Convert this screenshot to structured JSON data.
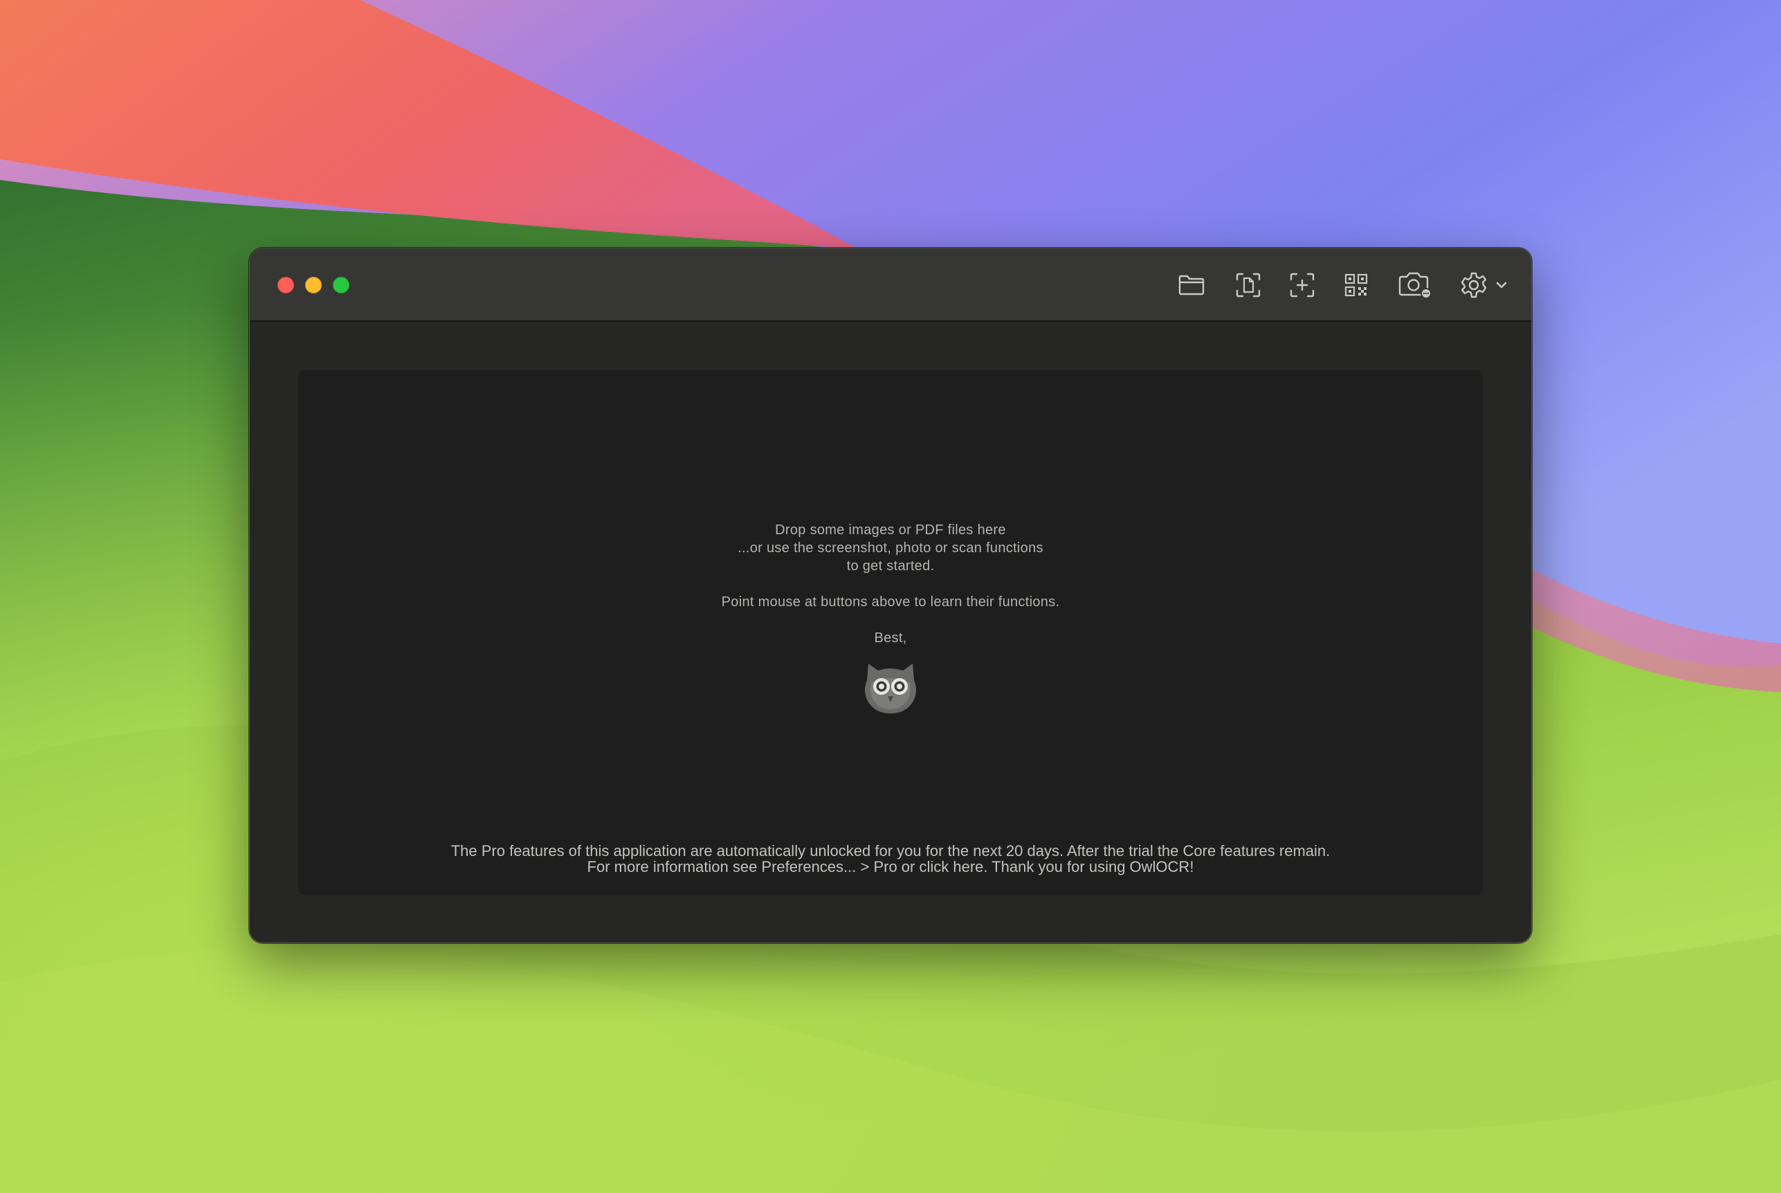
{
  "toolbar": {
    "buttons": [
      {
        "id": "open",
        "icon": "folder-icon"
      },
      {
        "id": "document-scan",
        "icon": "document-scan-icon"
      },
      {
        "id": "screenshot-area",
        "icon": "screenshot-area-icon"
      },
      {
        "id": "qr-code",
        "icon": "qr-code-icon"
      },
      {
        "id": "camera",
        "icon": "camera-icon"
      },
      {
        "id": "settings",
        "icon": "gear-icon"
      }
    ]
  },
  "welcome": {
    "line1": "Drop some images or PDF files here",
    "line2": "...or use the screenshot, photo or scan functions",
    "line3": "to get started.",
    "line4": "Point mouse at buttons above to learn their functions.",
    "signoff": "Best,",
    "mascot_icon": "owl-icon"
  },
  "trial_notice": {
    "line1": "The Pro features of this application are automatically unlocked for you for the next 20 days. After the trial the Core features remain.",
    "line2": "For more information see Preferences... > Pro or click here. Thank you for using OwlOCR!"
  },
  "colors": {
    "close": "#fe5f57",
    "minimize": "#febc2e",
    "zoom": "#28c840",
    "window_bg": "#262624",
    "titlebar_bg": "#363634",
    "content_bg": "#1e1e1e"
  }
}
